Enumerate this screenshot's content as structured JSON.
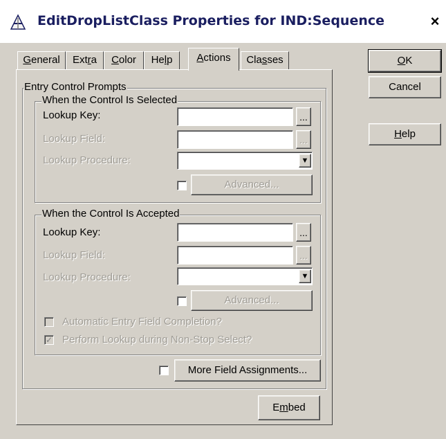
{
  "window": {
    "title": "EditDropListClass Properties for IND:Sequence",
    "close_glyph": "×",
    "title_icon": "class-properties-icon"
  },
  "tabs": [
    {
      "label": "General",
      "accel_pre": "",
      "accel": "G",
      "accel_post": "eneral",
      "active": false
    },
    {
      "label": "Extra",
      "accel_pre": "Ext",
      "accel": "r",
      "accel_post": "a",
      "active": false
    },
    {
      "label": "Color",
      "accel_pre": "",
      "accel": "C",
      "accel_post": "olor",
      "active": false
    },
    {
      "label": "Help",
      "accel_pre": "He",
      "accel": "l",
      "accel_post": "p",
      "active": false
    },
    {
      "label": "Actions",
      "accel_pre": "",
      "accel": "A",
      "accel_post": "ctions",
      "active": true
    },
    {
      "label": "Classes",
      "accel_pre": "Cla",
      "accel": "s",
      "accel_post": "ses",
      "active": false
    }
  ],
  "buttons": {
    "ok": {
      "accel": "O",
      "rest": "K"
    },
    "cancel": "Cancel",
    "help": {
      "accel": "H",
      "rest": "elp"
    },
    "embed": {
      "pre": "E",
      "accel": "m",
      "post": "bed"
    },
    "more_field_assignments": "More Field Assignments..."
  },
  "entry_group": {
    "title": "Entry Control Prompts",
    "selected": {
      "title": "When the Control Is Selected",
      "lookup_key_label": "Lookup Key:",
      "lookup_key_value": "",
      "lookup_field_label": "Lookup Field:",
      "lookup_field_value": "",
      "lookup_procedure_label": "Lookup Procedure:",
      "lookup_procedure_value": "",
      "ellipsis": "...",
      "advanced_label": "Advanced..."
    },
    "accepted": {
      "title": "When the Control Is Accepted",
      "lookup_key_label": "Lookup Key:",
      "lookup_key_value": "",
      "lookup_field_label": "Lookup Field:",
      "lookup_field_value": "",
      "lookup_procedure_label": "Lookup Procedure:",
      "lookup_procedure_value": "",
      "ellipsis": "...",
      "advanced_label": "Advanced...",
      "auto_completion_label": "Automatic Entry Field Completion?",
      "auto_completion_checked": false,
      "perform_lookup_label": "Perform Lookup during Non-Stop Select?",
      "perform_lookup_checked": true
    }
  },
  "glyphs": {
    "dropdown": "▼",
    "check": "✓"
  }
}
